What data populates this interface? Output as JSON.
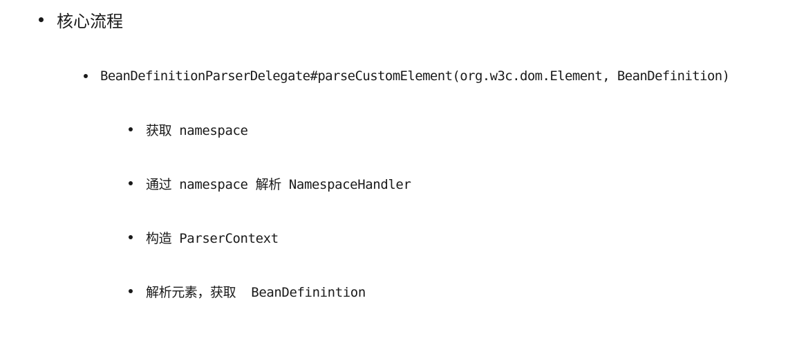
{
  "heading": "核心流程",
  "method": "BeanDefinitionParserDelegate#parseCustomElement(org.w3c.dom.Element, BeanDefinition)",
  "steps": [
    "获取 namespace",
    "通过 namespace 解析 NamespaceHandler",
    "构造 ParserContext",
    "解析元素，获取  BeanDefinintion"
  ]
}
